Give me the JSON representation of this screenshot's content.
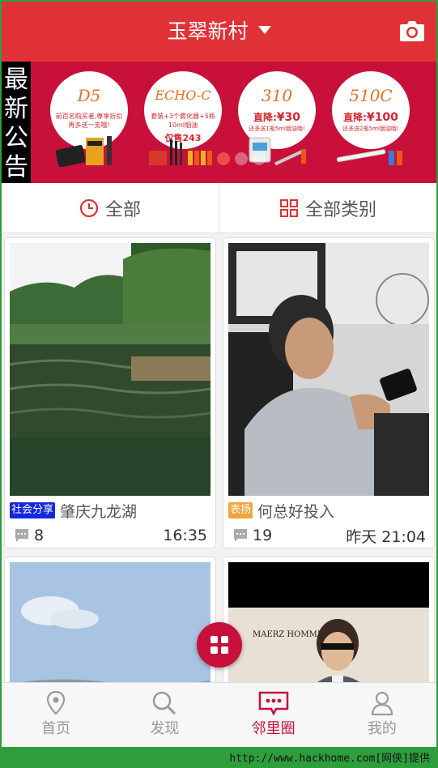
{
  "header": {
    "title": "玉翠新村",
    "camera_icon": "camera-icon",
    "dropdown_icon": "caret-down-icon",
    "accent": "#e03236"
  },
  "banner": {
    "notice": [
      "最",
      "新",
      "公",
      "告"
    ],
    "promos": [
      {
        "title": "D5",
        "text": "前百名购买者,尊享折扣再多送一支哦!"
      },
      {
        "title": "ECHO-C",
        "text": "套装+3个雾化器+5瓶10ml烟油",
        "price": "仅售243"
      },
      {
        "title": "310",
        "price_label": "直降:",
        "price": "¥30",
        "text": "还多送1瓶5ml烟油哦!"
      },
      {
        "title": "510C",
        "price_label": "直降:",
        "price": "¥100",
        "text": "还多送2瓶5ml烟油哦!"
      }
    ],
    "pages": 3,
    "active_page": 0,
    "color": "#c8103a"
  },
  "filter": {
    "left_label": "全部",
    "left_icon": "clock-icon",
    "right_label": "全部类别",
    "right_icon": "grid-icon"
  },
  "posts": [
    {
      "tag": "社会分享",
      "tag_color": "#1427e0",
      "title": "肇庆九龙湖",
      "comments": "8",
      "time": "16:35",
      "image": "lake-photo"
    },
    {
      "tag": "表扬",
      "tag_color": "#f2a43a",
      "title": "何总好投入",
      "comments": "19",
      "time": "昨天 21:04",
      "image": "man-with-phone-photo"
    },
    {
      "image": "sky-landscape-photo"
    },
    {
      "image": "man-fashion-ad-photo",
      "brand": "MAERZ HOMME"
    }
  ],
  "nav": {
    "items": [
      {
        "label": "首页",
        "icon": "location-pin-icon"
      },
      {
        "label": "发现",
        "icon": "search-icon"
      },
      {
        "label": "邻里圈",
        "icon": "chat-bubble-icon"
      },
      {
        "label": "我的",
        "icon": "person-icon"
      }
    ],
    "active_index": 2
  },
  "watermark": "http://www.hackhome.com[网侠]提供"
}
